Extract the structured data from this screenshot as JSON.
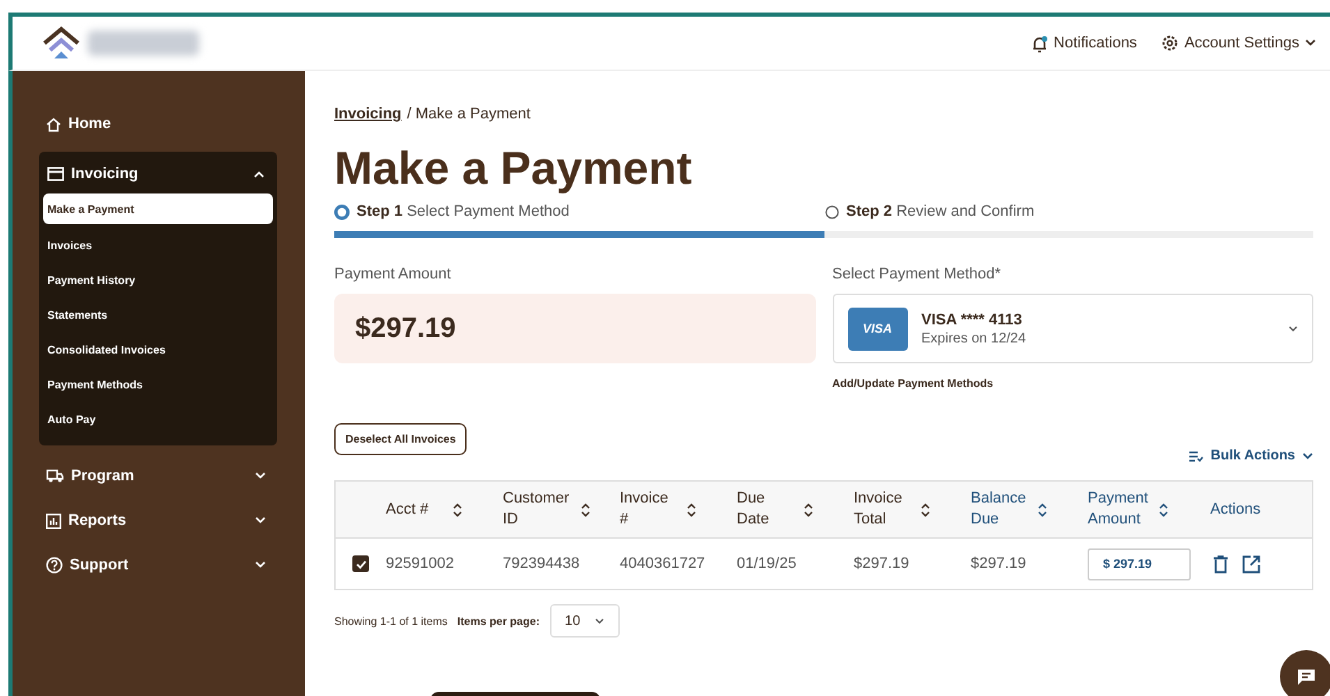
{
  "header": {
    "notifications": "Notifications",
    "account": "Account Settings"
  },
  "sidebar": {
    "items": [
      {
        "label": "Home"
      },
      {
        "label": "Invoicing",
        "expanded": true,
        "children": [
          {
            "label": "Make a Payment",
            "selected": true
          },
          {
            "label": "Invoices",
            "selected": false
          },
          {
            "label": "Payment History",
            "selected": false
          },
          {
            "label": "Statements",
            "selected": false
          },
          {
            "label": "Consolidated Invoices",
            "selected": false
          },
          {
            "label": "Payment Methods",
            "selected": false
          },
          {
            "label": "Auto Pay",
            "selected": false
          }
        ]
      },
      {
        "label": "Program",
        "expanded": false
      },
      {
        "label": "Reports",
        "expanded": false
      },
      {
        "label": "Support",
        "expanded": false
      }
    ]
  },
  "breadcrumb": {
    "link": "Invoicing",
    "current": "/ Make a Payment"
  },
  "title": "Make a Payment",
  "steps": [
    {
      "step": "Step 1",
      "label": "Select Payment Method",
      "selected": true
    },
    {
      "step": "Step 2",
      "label": "Review and Confirm",
      "selected": false
    }
  ],
  "payment_amount": {
    "label": "Payment Amount",
    "value": "$297.19"
  },
  "payment_method": {
    "label": "Select Payment Method*",
    "brand": "VISA",
    "card": "VISA **** 4113",
    "expires": "Expires on 12/24",
    "link": "Add/Update Payment Methods"
  },
  "deselect_button": "Deselect All Invoices",
  "bulk_actions": "Bulk Actions",
  "table": {
    "columns": [
      {
        "label": "Acct #",
        "highlighted": false,
        "sortable": true
      },
      {
        "label": "Customer ID",
        "highlighted": false,
        "sortable": true
      },
      {
        "label": "Invoice #",
        "highlighted": false,
        "sortable": true
      },
      {
        "label": "Due Date",
        "highlighted": false,
        "sortable": true
      },
      {
        "label": "Invoice Total",
        "highlighted": false,
        "sortable": true
      },
      {
        "label": "Balance Due",
        "highlighted": true,
        "sortable": true
      },
      {
        "label": "Payment Amount",
        "highlighted": true,
        "sortable": true
      },
      {
        "label": "Actions",
        "highlighted": true,
        "sortable": false
      }
    ],
    "rows": [
      {
        "checked": true,
        "cells": [
          "92591002",
          "792394438",
          "4040361727",
          "01/19/25",
          "$297.19",
          "$297.19"
        ],
        "payment": "$ 297.19"
      }
    ]
  },
  "pagination": {
    "showing": "Showing 1-1 of 1 items",
    "per_page_label": "Items per page:",
    "per_page": "10"
  }
}
